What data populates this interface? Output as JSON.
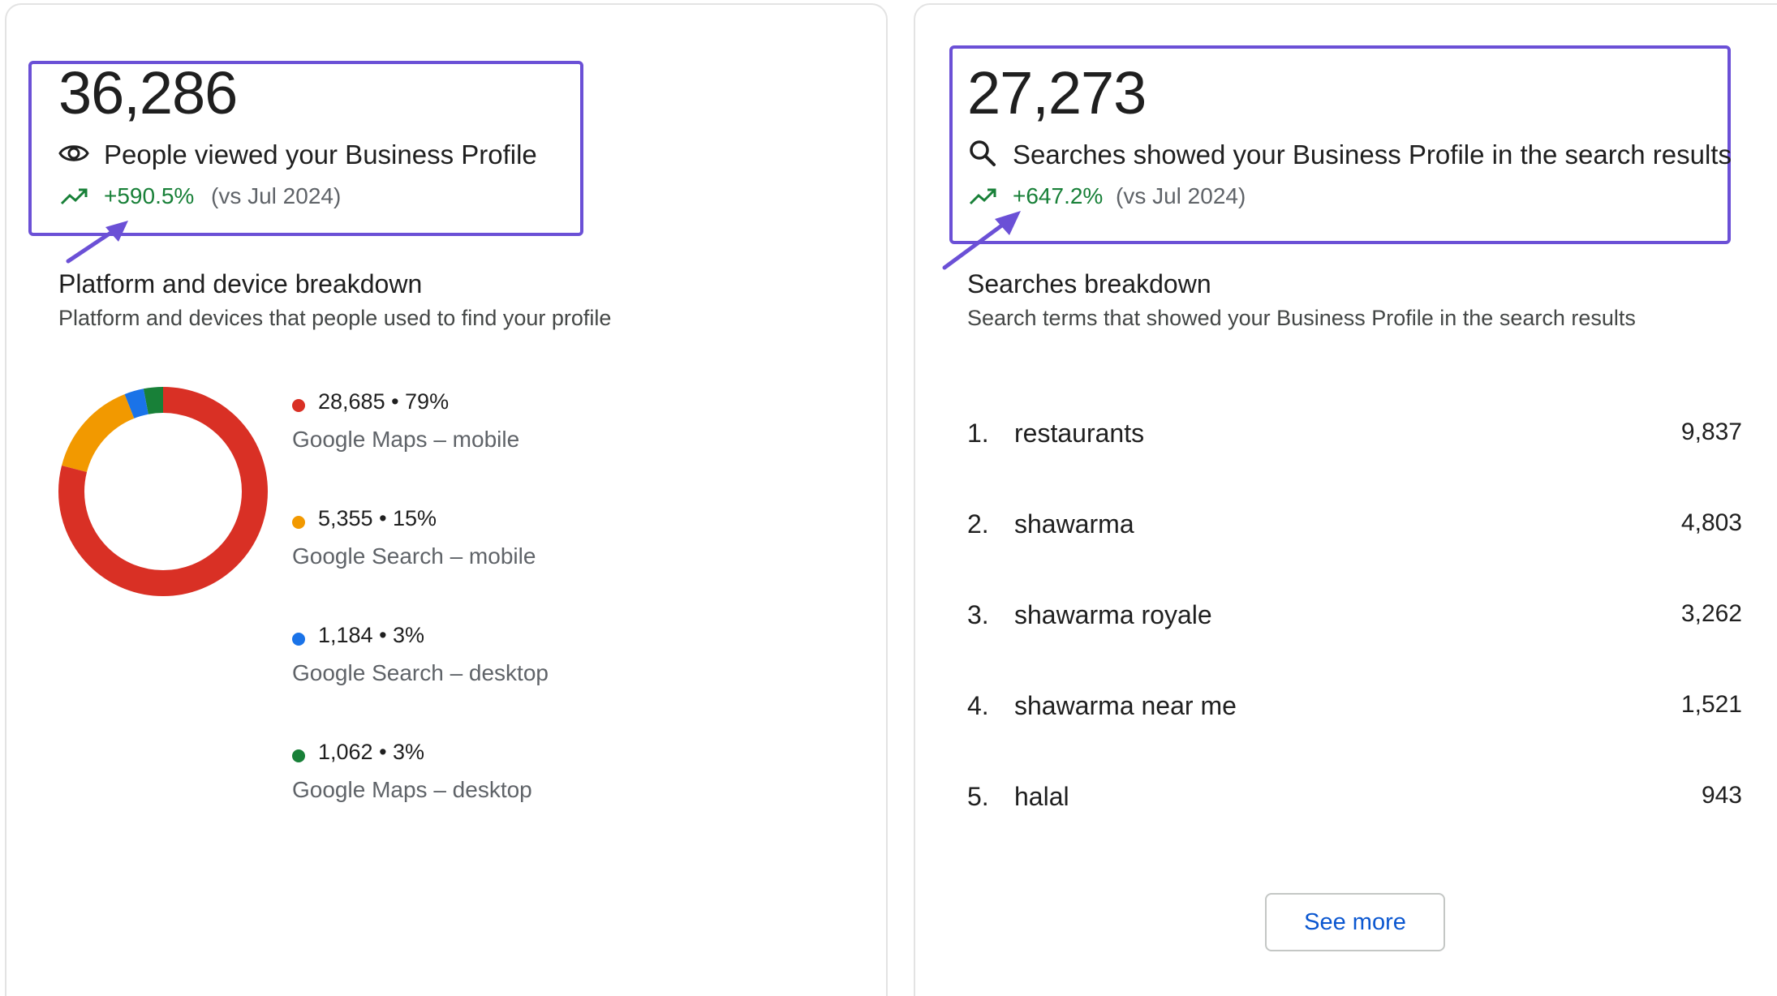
{
  "views_card": {
    "value": "36,286",
    "label": "People viewed your Business Profile",
    "icon": "eye-icon",
    "delta": "+590.5%",
    "delta_comparison": "(vs Jul 2024)",
    "breakdown_title": "Platform and device breakdown",
    "breakdown_subtitle": "Platform and devices that people used to find your profile",
    "breakdown": [
      {
        "value": "28,685 • 79%",
        "source": "Google Maps – mobile",
        "color": "#d93025",
        "percent": 79
      },
      {
        "value": "5,355 • 15%",
        "source": "Google Search – mobile",
        "color": "#f29900",
        "percent": 15
      },
      {
        "value": "1,184 • 3%",
        "source": "Google Search – desktop",
        "color": "#1a73e8",
        "percent": 3
      },
      {
        "value": "1,062 • 3%",
        "source": "Google Maps – desktop",
        "color": "#188038",
        "percent": 3
      }
    ]
  },
  "searches_card": {
    "value": "27,273",
    "label": "Searches showed your Business Profile in the search results",
    "icon": "search-icon",
    "delta": "+647.2%",
    "delta_comparison": "(vs Jul 2024)",
    "breakdown_title": "Searches breakdown",
    "breakdown_subtitle": "Search terms that showed your Business Profile in the search results",
    "terms": [
      {
        "rank": "1.",
        "term": "restaurants",
        "count": "9,837"
      },
      {
        "rank": "2.",
        "term": "shawarma",
        "count": "4,803"
      },
      {
        "rank": "3.",
        "term": "shawarma royale",
        "count": "3,262"
      },
      {
        "rank": "4.",
        "term": "shawarma near me",
        "count": "1,521"
      },
      {
        "rank": "5.",
        "term": "halal",
        "count": "943"
      }
    ],
    "see_more_label": "See more"
  },
  "colors": {
    "highlight": "#6b50d6",
    "positive": "#188038",
    "link": "#0b57d0"
  }
}
